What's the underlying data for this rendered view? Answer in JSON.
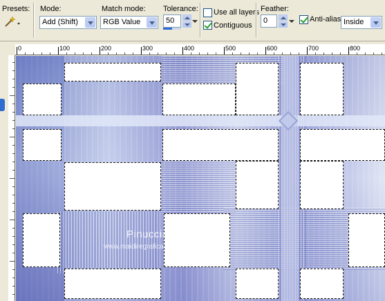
{
  "toolbar": {
    "presets_label": "Presets:",
    "mode_label": "Mode:",
    "mode_value": "Add (Shift)",
    "match_label": "Match mode:",
    "match_value": "RGB Value",
    "tolerance_label": "Tolerance:",
    "tolerance_value": "50",
    "use_all_layers_label": "Use all layers",
    "use_all_layers_checked": false,
    "contiguous_label": "Contiguous",
    "contiguous_checked": true,
    "feather_label": "Feather:",
    "feather_value": "0",
    "antialias_label": "Anti-alias",
    "antialias_checked": true,
    "antialias_mode_value": "Inside"
  },
  "ruler": {
    "ticks": [
      "0",
      "100",
      "200",
      "300",
      "400",
      "500",
      "600",
      "700",
      "800"
    ]
  },
  "canvas": {
    "watermark_title": "Pinuccia",
    "watermark_url": "www.maidiregrafica.eu"
  },
  "icons": {
    "presets": "magic-wand-icon"
  }
}
